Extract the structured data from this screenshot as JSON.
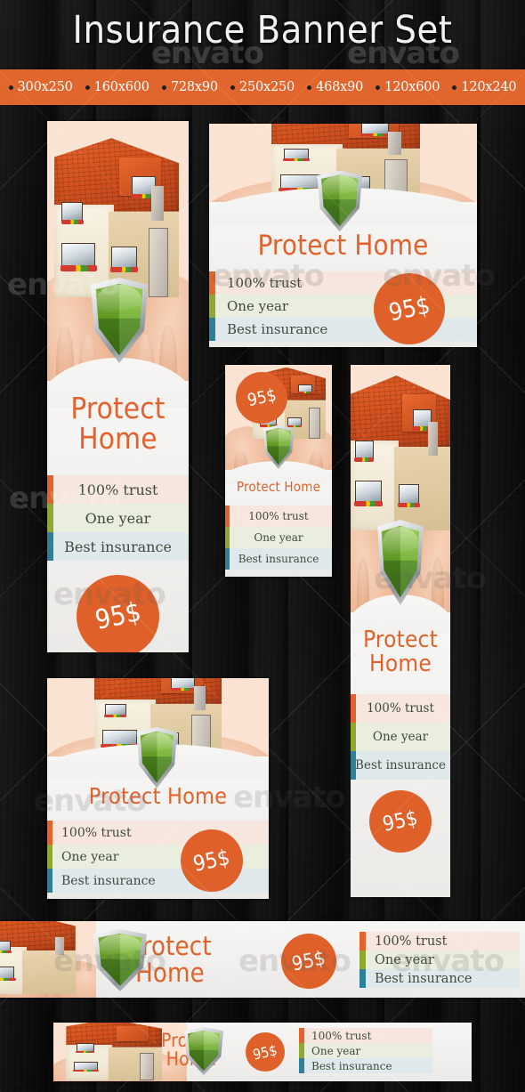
{
  "header": {
    "title": "Insurance Banner Set",
    "sizes": [
      "300x250",
      "160x600",
      "728x90",
      "250x250",
      "468x90",
      "120x600",
      "120x240"
    ]
  },
  "colors": {
    "accent_orange": "#e1662e",
    "price_orange": "#df6129",
    "feature_orange": "#e4622c",
    "feature_green": "#8fa82e",
    "feature_blue": "#2e8099",
    "headline_orange": "#e1622c",
    "panel_background": "#f3f3f2",
    "page_background": "#0c0c0c"
  },
  "banner": {
    "headline_line1": "Protect",
    "headline_line2": "Home",
    "headline_inline": "Protect Home",
    "price": "95$",
    "features": [
      "100% trust",
      "One year",
      "Best insurance"
    ]
  },
  "watermark": {
    "text": "envato"
  },
  "banners": [
    {
      "id": "b-160x600",
      "size": "160x600",
      "layout": "vertical-stacked-headline"
    },
    {
      "id": "b-300x250",
      "size": "300x250",
      "layout": "inline-headline-left-features"
    },
    {
      "id": "b-250x250",
      "size": "250x250",
      "layout": "inline-headline-centered-features"
    },
    {
      "id": "b-120x600",
      "size": "120x600",
      "layout": "vertical-stacked-headline"
    },
    {
      "id": "b-120x240",
      "size": "120x240",
      "layout": "inline-headline-left-features"
    },
    {
      "id": "b-728x90",
      "size": "728x90",
      "layout": "horizontal-strip"
    },
    {
      "id": "b-468x90",
      "size": "468x90",
      "layout": "horizontal-strip"
    }
  ]
}
